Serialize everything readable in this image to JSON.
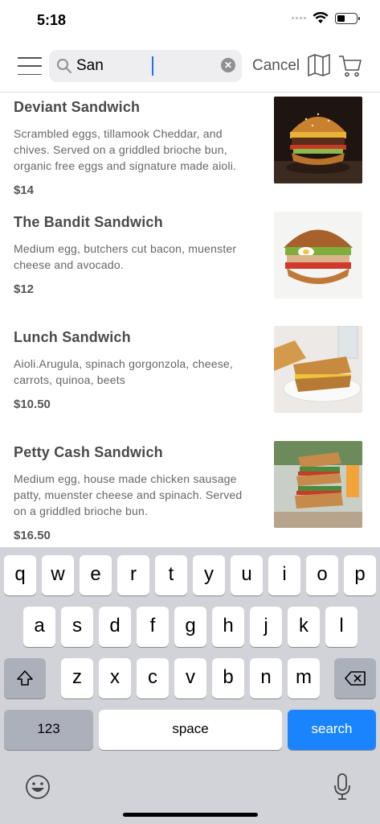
{
  "status": {
    "time": "5:18"
  },
  "header": {
    "search_value": "San",
    "cancel_label": "Cancel"
  },
  "menu_items": [
    {
      "name": "Deviant Sandwich",
      "description": "Scrambled eggs, tillamook Cheddar, and chives. Served on a griddled brioche bun, organic free eggs and signature made aioli.",
      "price": "$14"
    },
    {
      "name": "The Bandit Sandwich",
      "description": "Medium egg, butchers cut bacon, muenster cheese and avocado.",
      "price": "$12"
    },
    {
      "name": "Lunch Sandwich",
      "description": "Aioli.Arugula, spinach gorgonzola, cheese, carrots, quinoa, beets",
      "price": "$10.50"
    },
    {
      "name": "Petty Cash Sandwich",
      "description": "Medium egg, house made chicken sausage patty, muenster cheese and spinach. Served on a griddled brioche bun.",
      "price": "$16.50"
    }
  ],
  "keyboard": {
    "row1": [
      "q",
      "w",
      "e",
      "r",
      "t",
      "y",
      "u",
      "i",
      "o",
      "p"
    ],
    "row2": [
      "a",
      "s",
      "d",
      "f",
      "g",
      "h",
      "j",
      "k",
      "l"
    ],
    "row3": [
      "z",
      "x",
      "c",
      "v",
      "b",
      "n",
      "m"
    ],
    "numbers_label": "123",
    "space_label": "space",
    "search_label": "search"
  },
  "colors": {
    "accent": "#1a84ff",
    "keyboard_bg": "#d1d3d9"
  }
}
